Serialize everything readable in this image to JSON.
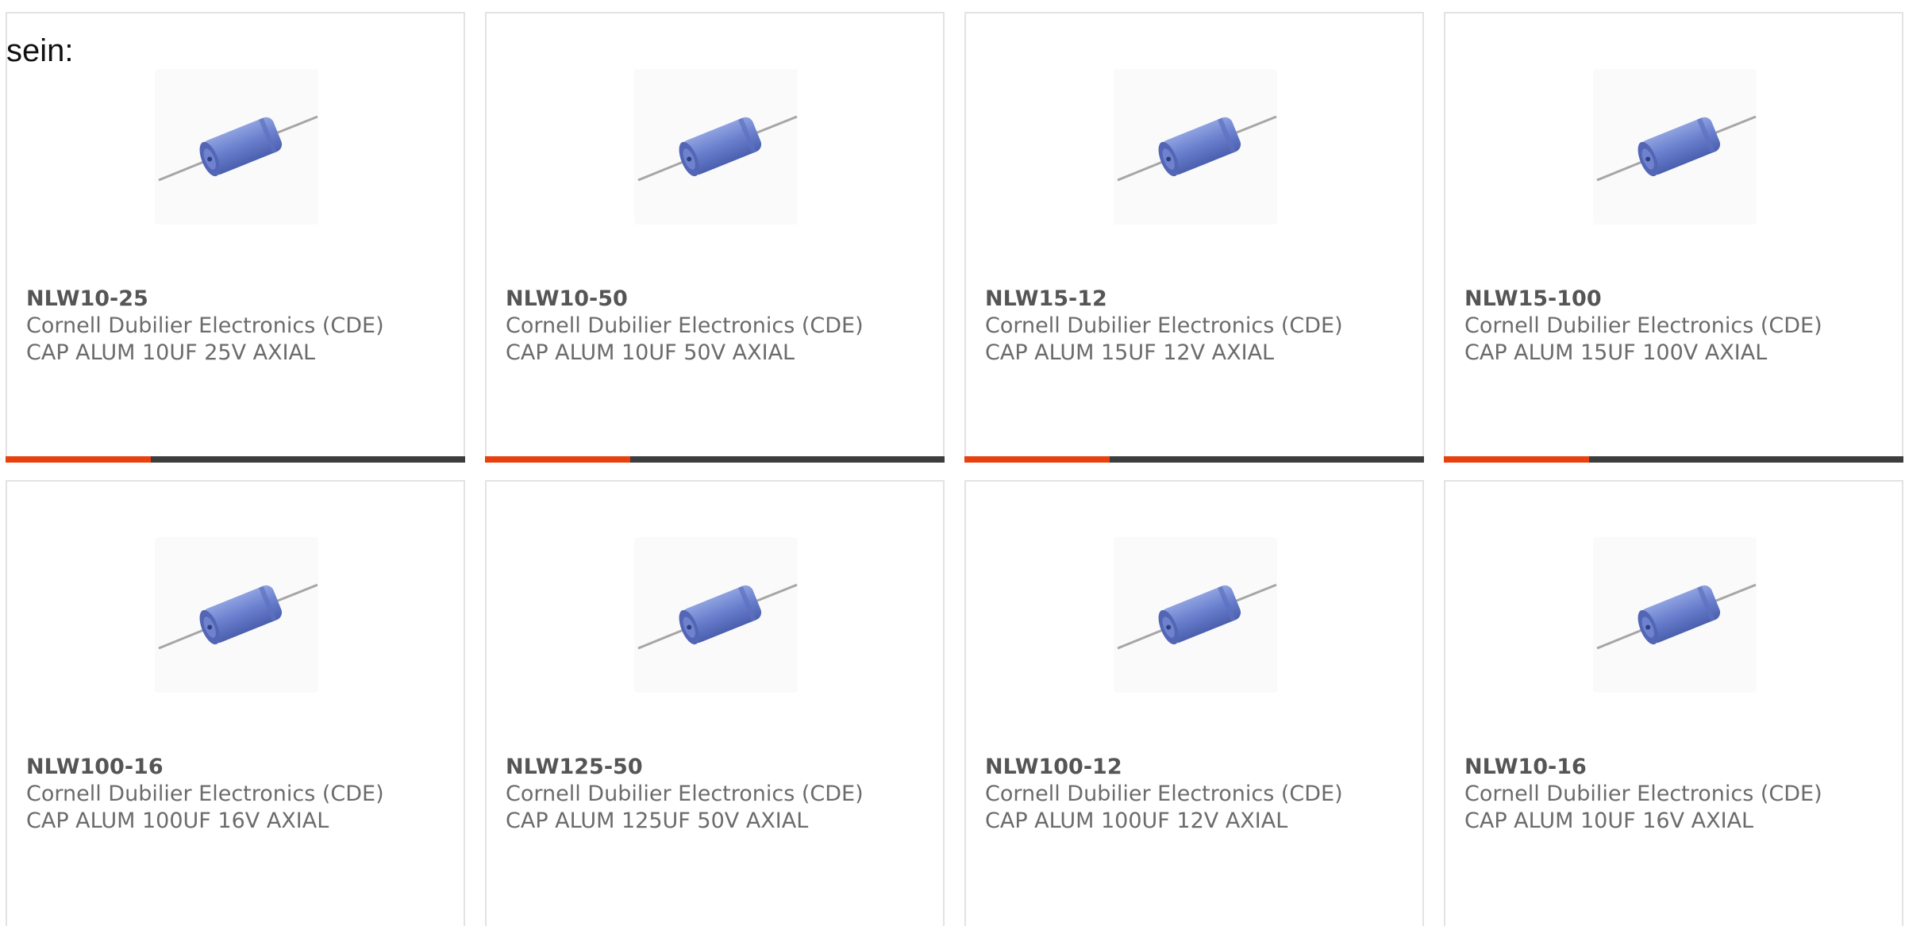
{
  "intro_text": "sein:",
  "accent_color": "#e8410f",
  "bar_color": "#3d3d3d",
  "products": [
    {
      "part_number": "NLW10-25",
      "manufacturer": "Cornell Dubilier Electronics (CDE)",
      "description": "CAP ALUM 10UF 25V AXIAL",
      "image_icon": "axial-capacitor-icon",
      "show_bar": true
    },
    {
      "part_number": "NLW10-50",
      "manufacturer": "Cornell Dubilier Electronics (CDE)",
      "description": "CAP ALUM 10UF 50V AXIAL",
      "image_icon": "axial-capacitor-icon",
      "show_bar": true
    },
    {
      "part_number": "NLW15-12",
      "manufacturer": "Cornell Dubilier Electronics (CDE)",
      "description": "CAP ALUM 15UF 12V AXIAL",
      "image_icon": "axial-capacitor-icon",
      "show_bar": true
    },
    {
      "part_number": "NLW15-100",
      "manufacturer": "Cornell Dubilier Electronics (CDE)",
      "description": "CAP ALUM 15UF 100V AXIAL",
      "image_icon": "axial-capacitor-icon",
      "show_bar": true
    },
    {
      "part_number": "NLW100-16",
      "manufacturer": "Cornell Dubilier Electronics (CDE)",
      "description": "CAP ALUM 100UF 16V AXIAL",
      "image_icon": "axial-capacitor-icon",
      "show_bar": false
    },
    {
      "part_number": "NLW125-50",
      "manufacturer": "Cornell Dubilier Electronics (CDE)",
      "description": "CAP ALUM 125UF 50V AXIAL",
      "image_icon": "axial-capacitor-icon",
      "show_bar": false
    },
    {
      "part_number": "NLW100-12",
      "manufacturer": "Cornell Dubilier Electronics (CDE)",
      "description": "CAP ALUM 100UF 12V AXIAL",
      "image_icon": "axial-capacitor-icon",
      "show_bar": false
    },
    {
      "part_number": "NLW10-16",
      "manufacturer": "Cornell Dubilier Electronics (CDE)",
      "description": "CAP ALUM 10UF 16V AXIAL",
      "image_icon": "axial-capacitor-icon",
      "show_bar": false
    }
  ]
}
